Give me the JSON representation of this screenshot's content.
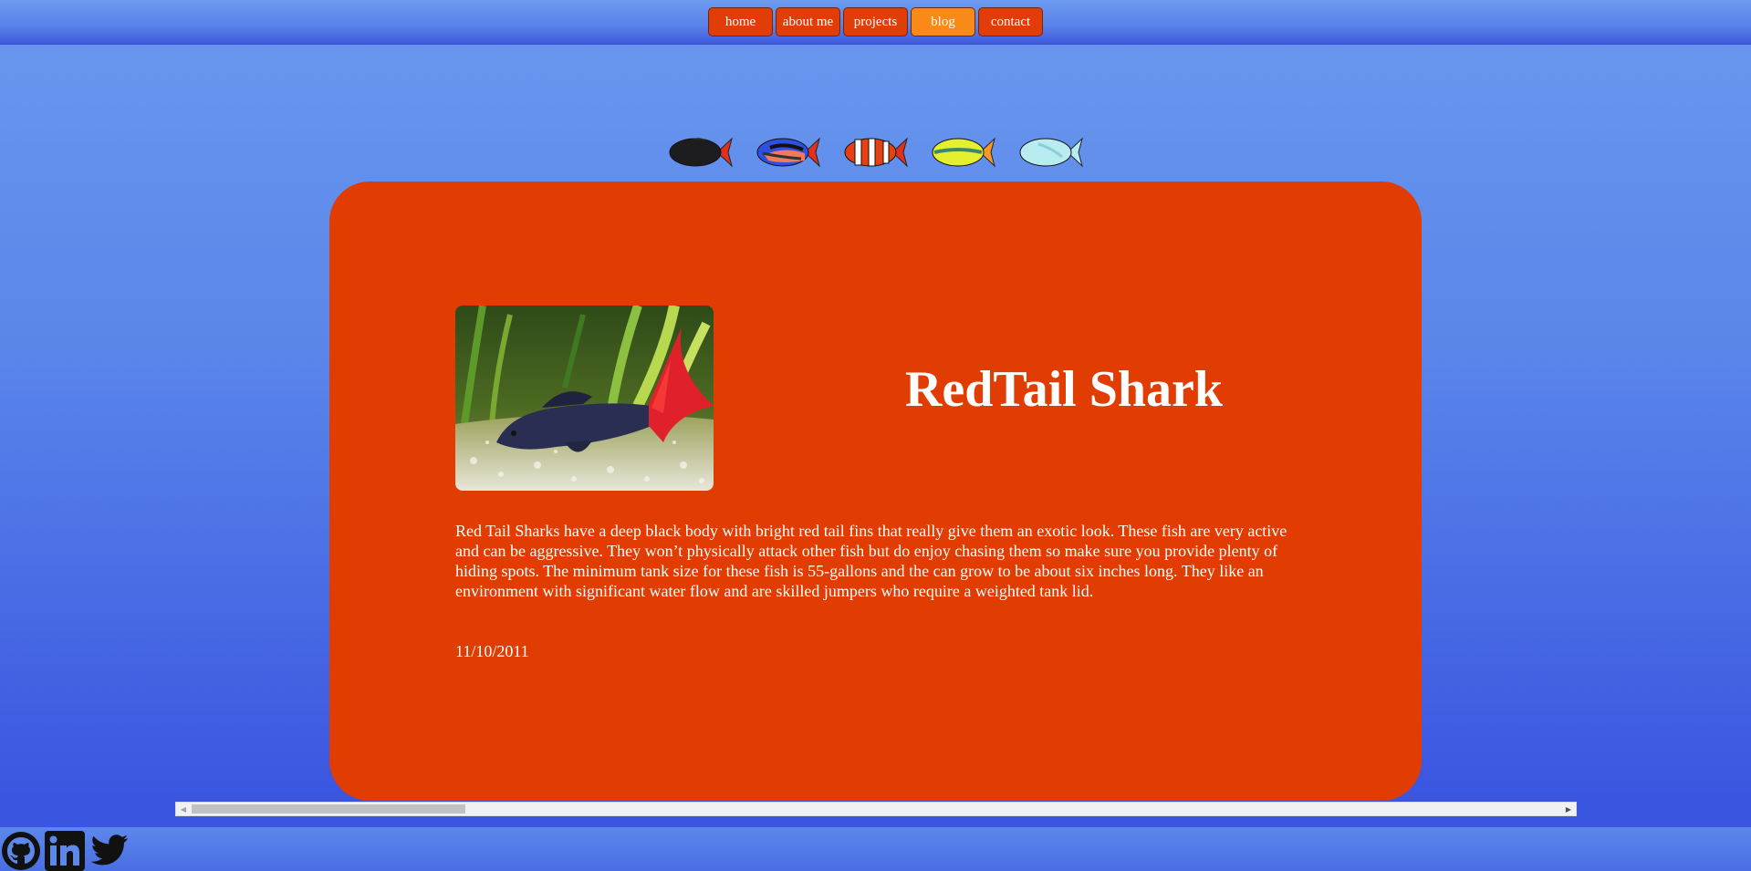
{
  "nav": {
    "items": [
      {
        "label": "home"
      },
      {
        "label": "about me"
      },
      {
        "label": "projects"
      },
      {
        "label": "blog",
        "active": true
      },
      {
        "label": "contact"
      }
    ]
  },
  "fish": [
    "black-fish-icon",
    "blue-tang-fish-icon",
    "clownfish-icon",
    "yellow-striped-fish-icon",
    "light-blue-fish-icon"
  ],
  "post": {
    "title": "RedTail Shark",
    "body": "Red Tail Sharks have a deep black body with bright red tail fins that really give them an exotic look. These fish are very active and can be aggressive. They won’t physically attack other fish but do enjoy chasing them so make sure you provide plenty of hiding spots. The minimum tank size for these fish is 55-gallons and the can grow to be about six inches long. They like an environment with significant water flow and are skilled jumpers who require a weighted tank lid.",
    "date": "11/10/2011",
    "image": "red-tail-shark-photo"
  },
  "social": [
    "github-icon",
    "linkedin-icon",
    "twitter-icon"
  ],
  "colors": {
    "card": "#e13c01",
    "nav_button": "#e03d08",
    "nav_active": "#f98a18",
    "background_top": "#6a98ee",
    "background_bottom": "#3a55e0"
  }
}
